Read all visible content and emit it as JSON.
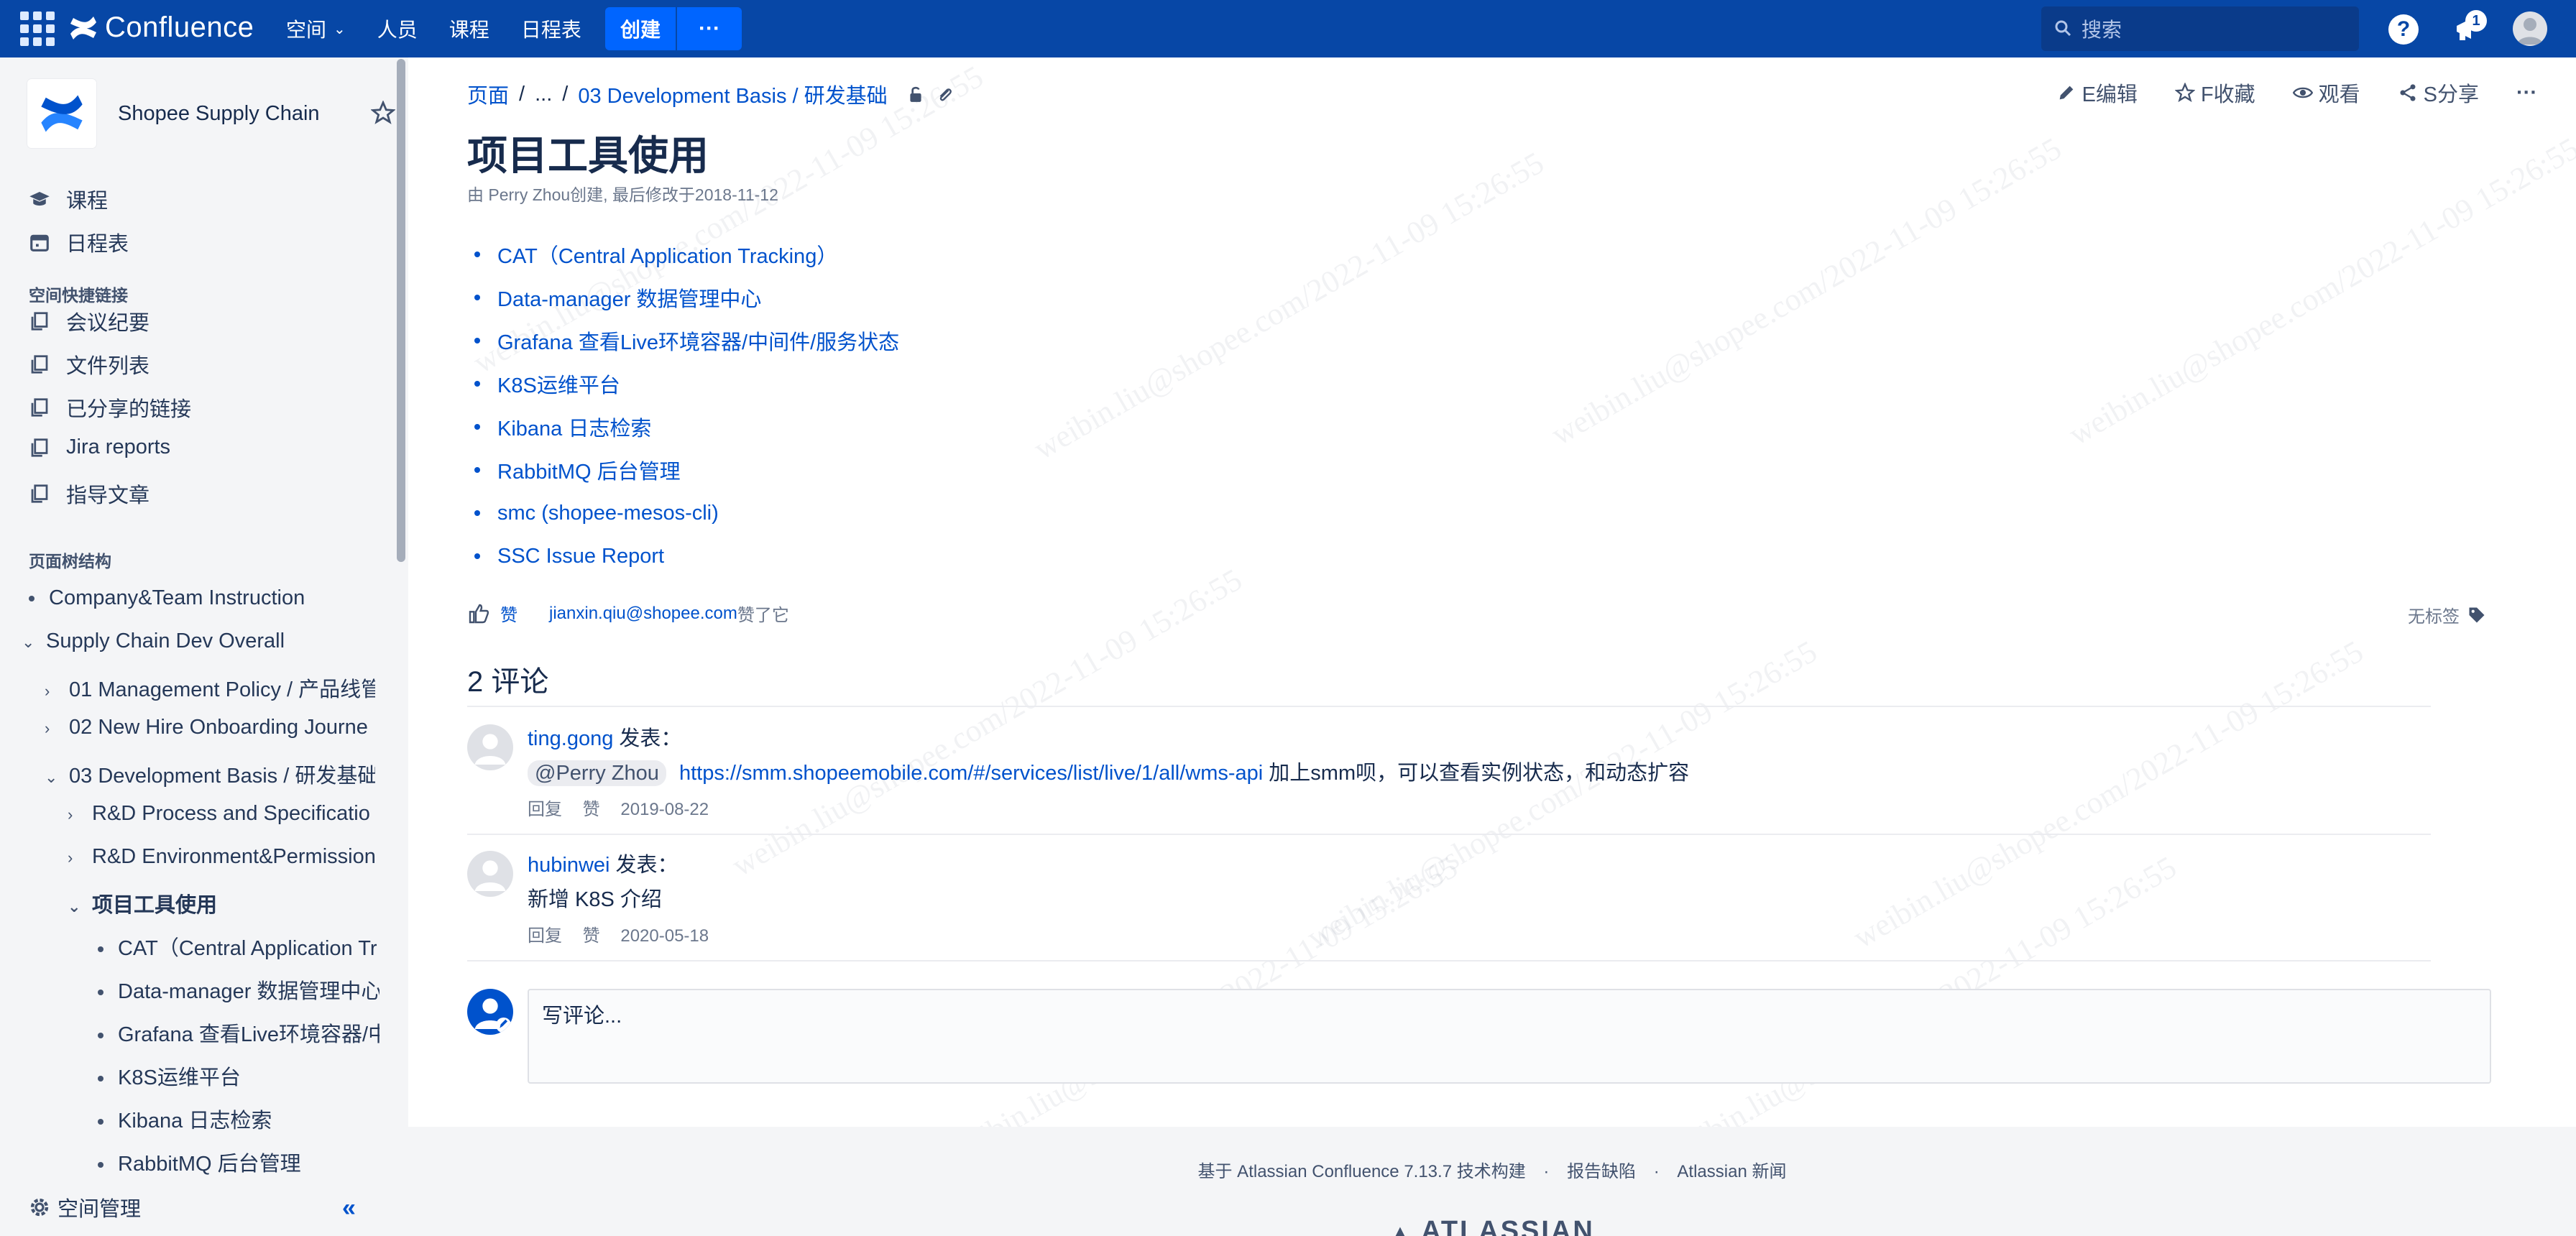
{
  "topnav": {
    "brand": "Confluence",
    "items": [
      {
        "label": "空间",
        "has_dropdown": true
      },
      {
        "label": "人员"
      },
      {
        "label": "课程"
      },
      {
        "label": "日程表"
      }
    ],
    "create_label": "创建",
    "more_label": "···",
    "search_placeholder": "搜索",
    "help_label": "?",
    "notification_count": "1",
    "brand_color": "#0747a6"
  },
  "sidebar": {
    "space_name": "Shopee Supply Chain",
    "nav": [
      {
        "label": "课程",
        "icon": "graduation-icon"
      },
      {
        "label": "日程表",
        "icon": "calendar-icon"
      }
    ],
    "shortcuts_title": "空间快捷链接",
    "shortcuts": [
      {
        "label": "会议纪要",
        "icon": "copy-icon"
      },
      {
        "label": "文件列表",
        "icon": "copy-icon"
      },
      {
        "label": "已分享的链接",
        "icon": "copy-icon"
      },
      {
        "label": "Jira reports",
        "icon": "copy-icon"
      },
      {
        "label": "指导文章",
        "icon": "copy-icon"
      }
    ],
    "tree_title": "页面树结构",
    "tree": [
      {
        "label": "Company&Team Instruction",
        "level": 0,
        "state": "leaf"
      },
      {
        "label": "Supply Chain Dev Overall",
        "level": 0,
        "state": "expanded"
      },
      {
        "label": "01 Management Policy / 产品线管",
        "level": 1,
        "state": "collapsed"
      },
      {
        "label": "02 New Hire Onboarding Journe",
        "level": 1,
        "state": "collapsed"
      },
      {
        "label": "03 Development Basis / 研发基础",
        "level": 1,
        "state": "expanded"
      },
      {
        "label": "R&D Process and Specificatio",
        "level": 2,
        "state": "collapsed"
      },
      {
        "label": "R&D Environment&Permission",
        "level": 2,
        "state": "collapsed"
      },
      {
        "label": "项目工具使用",
        "level": 2,
        "state": "expanded",
        "current": true
      },
      {
        "label": "CAT（Central Application Tr",
        "level": 3,
        "state": "leaf"
      },
      {
        "label": "Data-manager 数据管理中心",
        "level": 3,
        "state": "leaf"
      },
      {
        "label": "Grafana 查看Live环境容器/中",
        "level": 3,
        "state": "leaf"
      },
      {
        "label": "K8S运维平台",
        "level": 3,
        "state": "leaf"
      },
      {
        "label": "Kibana 日志检索",
        "level": 3,
        "state": "leaf"
      },
      {
        "label": "RabbitMQ 后台管理",
        "level": 3,
        "state": "leaf"
      }
    ],
    "footer_label": "空间管理",
    "collapse_label": "«"
  },
  "page": {
    "breadcrumbs": [
      "页面",
      "...",
      "03 Development Basis / 研发基础"
    ],
    "actions": [
      {
        "label": "E编辑",
        "icon": "pencil-icon"
      },
      {
        "label": "F收藏",
        "icon": "star-icon"
      },
      {
        "label": "观看",
        "icon": "eye-icon"
      },
      {
        "label": "S分享",
        "icon": "share-icon"
      },
      {
        "label": "···",
        "icon": "more-icon"
      }
    ],
    "title": "项目工具使用",
    "byline": "由 Perry Zhou创建, 最后修改于2018-11-12",
    "links": [
      "CAT（Central Application Tracking）",
      "Data-manager 数据管理中心",
      "Grafana 查看Live环境容器/中间件/服务状态",
      "K8S运维平台",
      "Kibana 日志检索",
      "RabbitMQ 后台管理",
      "smc (shopee-mesos-cli)",
      "SSC Issue Report"
    ],
    "like_label": "赞",
    "liked_by": "jianxin.qiu@shopee.com",
    "liked_suffix": "赞了它",
    "no_labels": "无标签",
    "comments_title": "2 评论",
    "comments": [
      {
        "author": "ting.gong",
        "posted": "发表：",
        "mention": "@Perry Zhou",
        "link": "https://smm.shopeemobile.com/#/services/list/live/1/all/wms-api",
        "text": " 加上smm呗，可以查看实例状态，和动态扩容",
        "reply": "回复",
        "like": "赞",
        "date": "2019-08-22"
      },
      {
        "author": "hubinwei",
        "posted": "发表：",
        "text": "新增 K8S 介绍",
        "reply": "回复",
        "like": "赞",
        "date": "2020-05-18"
      }
    ],
    "write_placeholder": "写评论..."
  },
  "footer": {
    "built_with": "基于 Atlassian Confluence 7.13.7 技术构建",
    "report_bug": "报告缺陷",
    "news": "Atlassian 新闻",
    "logo": "ATLASSIAN"
  }
}
